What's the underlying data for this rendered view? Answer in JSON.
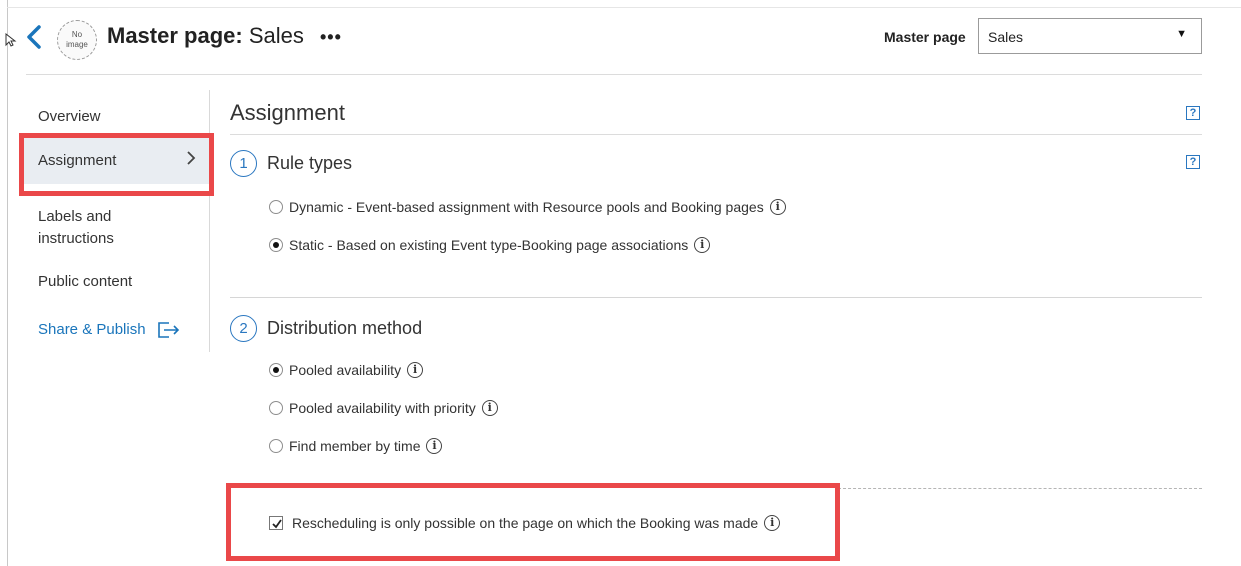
{
  "header": {
    "no_image_line1": "No",
    "no_image_line2": "image",
    "title_prefix": "Master page:",
    "title_name": "Sales",
    "more_label": "•••",
    "master_page_label": "Master page",
    "master_page_value": "Sales"
  },
  "sidebar": {
    "items": [
      {
        "label": "Overview"
      },
      {
        "label": "Assignment"
      },
      {
        "label": "Labels and instructions"
      },
      {
        "label": "Public content"
      },
      {
        "label": "Share & Publish"
      }
    ],
    "selected_index": 1
  },
  "main": {
    "section_title": "Assignment",
    "help_glyph": "?",
    "steps": [
      {
        "number": "1",
        "title": "Rule types",
        "options": [
          {
            "label": "Dynamic - Event-based assignment with Resource pools and Booking pages",
            "checked": false
          },
          {
            "label": "Static - Based on existing Event type-Booking page associations",
            "checked": true
          }
        ]
      },
      {
        "number": "2",
        "title": "Distribution method",
        "options": [
          {
            "label": "Pooled availability",
            "checked": true
          },
          {
            "label": "Pooled availability with priority",
            "checked": false
          },
          {
            "label": "Find member by time",
            "checked": false
          }
        ]
      }
    ],
    "rescheduling": {
      "label": "Rescheduling is only possible on the page on which the Booking was made",
      "checked": true
    },
    "info_glyph": "i"
  },
  "colors": {
    "accent": "#1a75bb",
    "highlight": "#ea4849",
    "selected_bg": "#e9edf2"
  }
}
